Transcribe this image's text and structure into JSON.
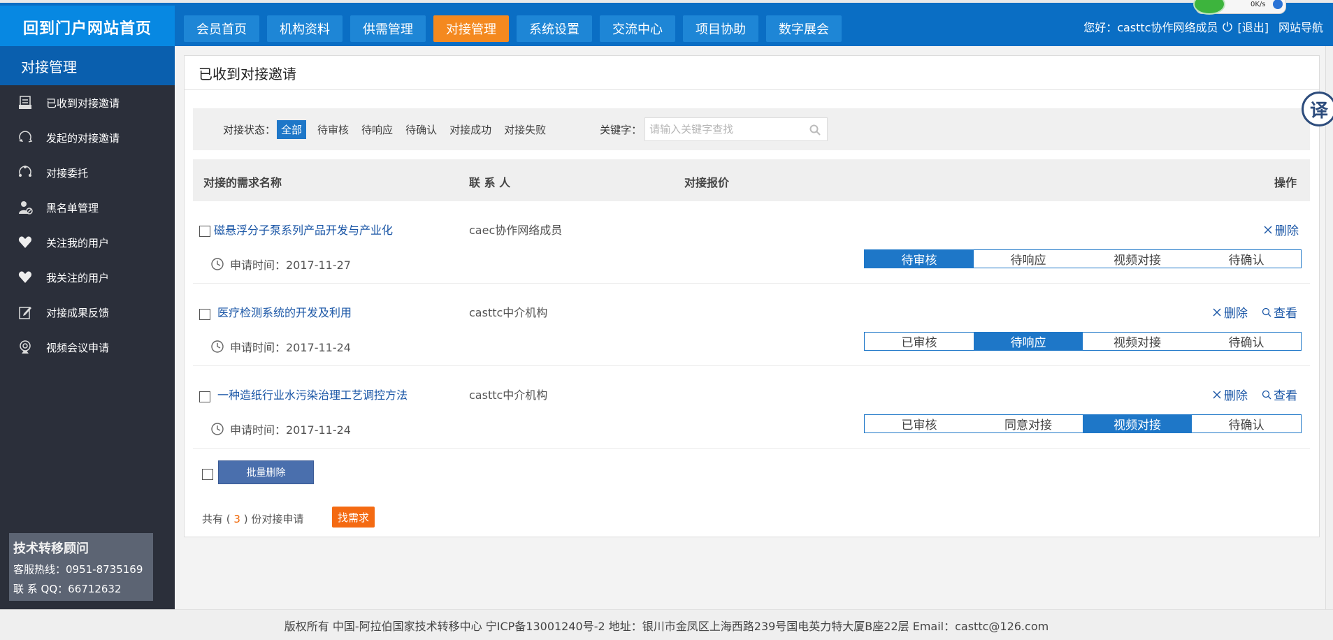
{
  "header": {
    "home_label": "回到门户网站首页",
    "nav": [
      {
        "label": "会员首页"
      },
      {
        "label": "机构资料"
      },
      {
        "label": "供需管理"
      },
      {
        "label": "对接管理"
      },
      {
        "label": "系统设置"
      },
      {
        "label": "交流中心"
      },
      {
        "label": "项目协助"
      },
      {
        "label": "数字展会"
      }
    ],
    "active_nav": "对接管理",
    "greeting": "您好：casttc协作网络成员",
    "logout": "[退出]",
    "site_nav": "网站导航",
    "widget_speed": "0K/s"
  },
  "sidebar": {
    "title": "对接管理",
    "items": [
      {
        "label": "已收到对接邀请",
        "icon": "inbox-icon"
      },
      {
        "label": "发起的对接邀请",
        "icon": "send-circle-icon"
      },
      {
        "label": "对接委托",
        "icon": "delegate-icon"
      },
      {
        "label": "黑名单管理",
        "icon": "user-block-icon"
      },
      {
        "label": "关注我的用户",
        "icon": "heart-icon"
      },
      {
        "label": "我关注的用户",
        "icon": "heart-icon"
      },
      {
        "label": "对接成果反馈",
        "icon": "edit-icon"
      },
      {
        "label": "视频会议申请",
        "icon": "webcam-icon"
      }
    ],
    "consult": {
      "title": "技术转移顾问",
      "hotline": "客服热线：0951-8735169",
      "qq": "联 系 QQ：66712632"
    }
  },
  "main": {
    "title": "已收到对接邀请",
    "filter": {
      "label": "对接状态：",
      "options": [
        "全部",
        "待审核",
        "待响应",
        "待确认",
        "对接成功",
        "对接失败"
      ],
      "active": "全部",
      "keyword_label": "关键字：",
      "search_placeholder": "请输入关键字查找"
    },
    "columns": [
      "对接的需求名称",
      "联 系 人",
      "对接报价",
      "操作"
    ],
    "rows": [
      {
        "title": "磁悬浮分子泵系列产品开发与产业化",
        "contact": "caec协作网络成员",
        "time": "申请时间：2017-11-27",
        "actions": [
          "删除"
        ],
        "steps": [
          "待审核",
          "待响应",
          "视频对接",
          "待确认"
        ],
        "active_step": 0
      },
      {
        "title": "医疗检测系统的开发及利用",
        "contact": "casttc中介机构",
        "time": "申请时间：2017-11-24",
        "actions": [
          "删除",
          "查看"
        ],
        "steps": [
          "已审核",
          "待响应",
          "视频对接",
          "待确认"
        ],
        "active_step": 1
      },
      {
        "title": "一种造纸行业水污染治理工艺调控方法",
        "contact": "casttc中介机构",
        "time": "申请时间：2017-11-24",
        "actions": [
          "删除",
          "查看"
        ],
        "steps": [
          "已审核",
          "同意对接",
          "视频对接",
          "待确认"
        ],
        "active_step": 2
      }
    ],
    "batch_delete": "批量删除",
    "total_prefix": "共有 (",
    "total_count": "3",
    "total_suffix": ") 份对接申请",
    "find_button": "找需求"
  },
  "translate_label": "译",
  "footer": "版权所有 中国-阿拉伯国家技术转移中心 宁ICP备13001240号-2    地址：银川市金凤区上海西路239号国电英力特大厦B座22层 Email：casttc@126.com",
  "colors": {
    "topbar": "#0a6ec4",
    "active_nav": "#f4891f",
    "sidebar": "#2b2f3a",
    "accent": "#1e77c8",
    "find_button": "#f46a12"
  }
}
